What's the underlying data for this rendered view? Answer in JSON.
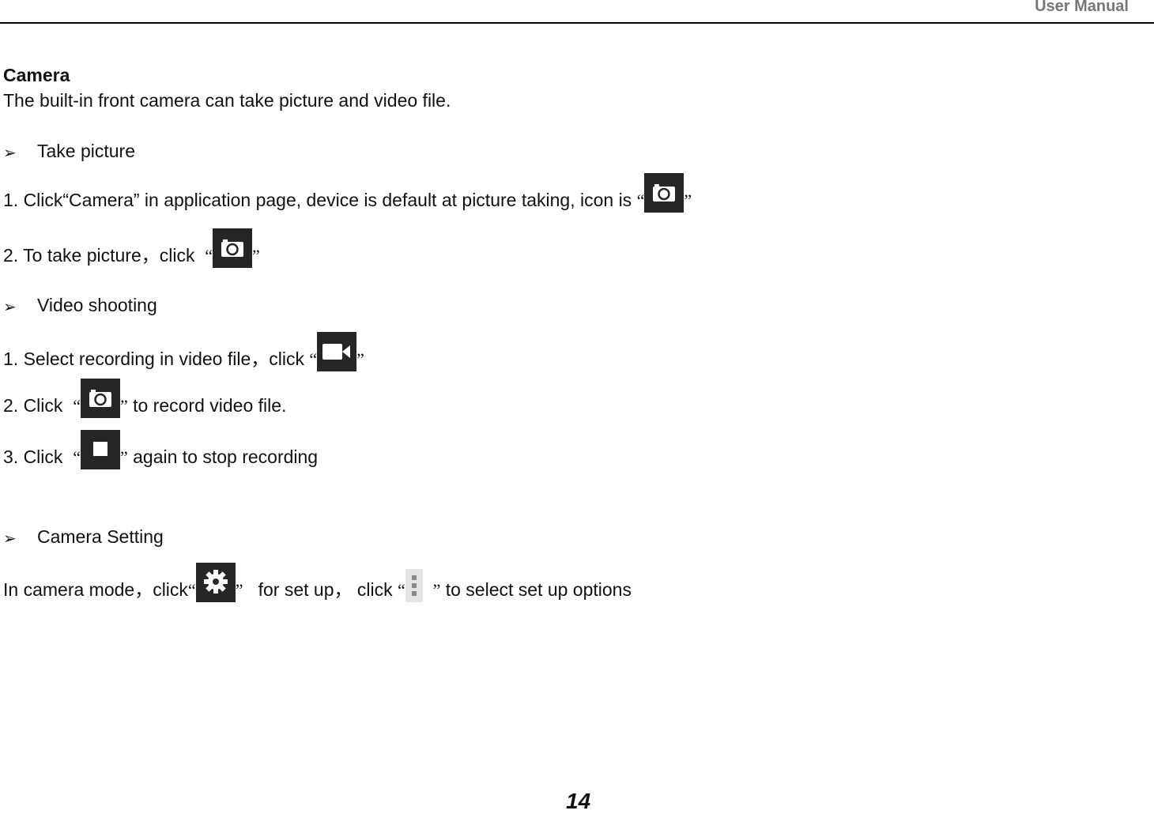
{
  "header": {
    "title": "User Manual"
  },
  "section": {
    "title": "Camera",
    "intro": "The built-in front camera can take picture and video file."
  },
  "take_picture": {
    "heading": "Take picture",
    "step1_before": "1. Click“Camera” in application page, device is default at picture taking, icon is",
    "step2_before": "2. To take picture，click"
  },
  "video": {
    "heading": "Video shooting",
    "step1_before": "1. Select recording in video file，click",
    "step2_before": "2. Click",
    "step2_after": "to record video file.",
    "step3_before": "3. Click",
    "step3_after": "again to stop recording"
  },
  "settings": {
    "heading": "Camera Setting",
    "before": "In camera mode，click",
    "middle": "for set up，   click",
    "after": "to select set up options"
  },
  "quotes": {
    "open": "“",
    "close": "”"
  },
  "bullet_glyph": "➢",
  "icons": {
    "camera": "camera-icon",
    "video": "video-camera-icon",
    "stop": "stop-icon",
    "settings": "gear-icon",
    "menu": "overflow-menu-icon"
  },
  "page_number": "14"
}
